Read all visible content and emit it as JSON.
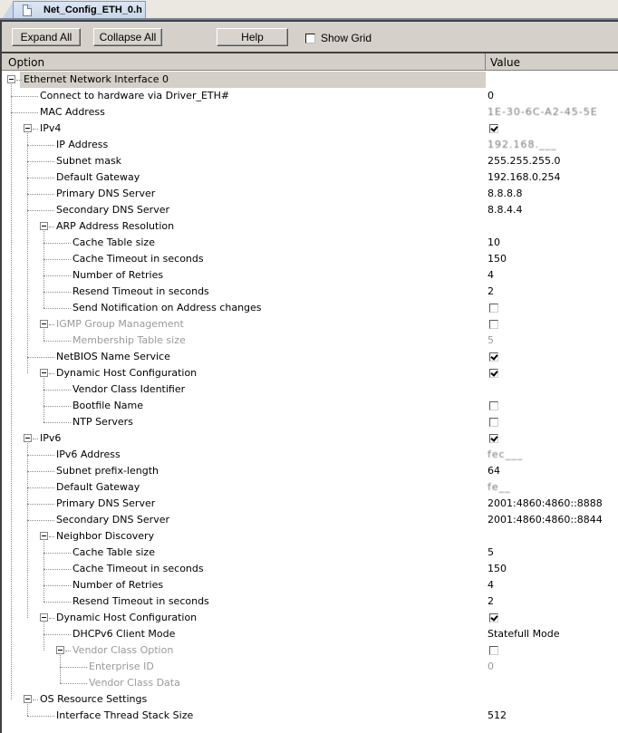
{
  "tab": {
    "label": "Net_Config_ETH_0.h",
    "icon": "document-icon"
  },
  "toolbar": {
    "expand_all": "Expand All",
    "collapse_all": "Collapse All",
    "help": "Help",
    "show_grid": "Show Grid",
    "show_grid_checked": false
  },
  "columns": {
    "option": "Option",
    "value": "Value"
  },
  "rows": [
    {
      "label": "Ethernet Network Interface 0",
      "level": 0,
      "expander": true,
      "value": ""
    },
    {
      "label": "Connect to hardware via Driver_ETH#",
      "level": 1,
      "value": "0"
    },
    {
      "label": "MAC Address",
      "level": 1,
      "value": "1E-30-6C-A2-45-5E",
      "obscured": true
    },
    {
      "label": "IPv4",
      "level": 1,
      "expander": true,
      "checkbox": true
    },
    {
      "label": "IP Address",
      "level": 2,
      "value": "192.168.___",
      "obscured": true
    },
    {
      "label": "Subnet mask",
      "level": 2,
      "value": "255.255.255.0"
    },
    {
      "label": "Default Gateway",
      "level": 2,
      "value": "192.168.0.254"
    },
    {
      "label": "Primary DNS Server",
      "level": 2,
      "value": "8.8.8.8"
    },
    {
      "label": "Secondary DNS Server",
      "level": 2,
      "value": "8.8.4.4"
    },
    {
      "label": "ARP Address Resolution",
      "level": 2,
      "expander": true,
      "value": ""
    },
    {
      "label": "Cache Table size",
      "level": 3,
      "value": "10"
    },
    {
      "label": "Cache Timeout in seconds",
      "level": 3,
      "value": "150"
    },
    {
      "label": "Number of Retries",
      "level": 3,
      "value": "4"
    },
    {
      "label": "Resend Timeout in seconds",
      "level": 3,
      "value": "2"
    },
    {
      "label": "Send Notification on Address changes",
      "level": 3,
      "checkbox": false
    },
    {
      "label": "IGMP Group Management",
      "level": 2,
      "expander": true,
      "checkbox": false,
      "disabled": true
    },
    {
      "label": "Membership Table size",
      "level": 3,
      "value": "5",
      "disabled": true
    },
    {
      "label": "NetBIOS Name Service",
      "level": 2,
      "checkbox": true
    },
    {
      "label": "Dynamic Host Configuration",
      "level": 2,
      "expander": true,
      "checkbox": true
    },
    {
      "label": "Vendor Class Identifier",
      "level": 3,
      "value": ""
    },
    {
      "label": "Bootfile Name",
      "level": 3,
      "checkbox": false
    },
    {
      "label": "NTP Servers",
      "level": 3,
      "checkbox": false
    },
    {
      "label": "IPv6",
      "level": 1,
      "expander": true,
      "checkbox": true
    },
    {
      "label": "IPv6 Address",
      "level": 2,
      "value": "fec___",
      "obscured": true
    },
    {
      "label": "Subnet prefix-length",
      "level": 2,
      "value": "64"
    },
    {
      "label": "Default Gateway",
      "level": 2,
      "value": "fe__",
      "obscured": true
    },
    {
      "label": "Primary DNS Server",
      "level": 2,
      "value": "2001:4860:4860::8888"
    },
    {
      "label": "Secondary DNS Server",
      "level": 2,
      "value": "2001:4860:4860::8844"
    },
    {
      "label": "Neighbor Discovery",
      "level": 2,
      "expander": true,
      "value": ""
    },
    {
      "label": "Cache Table size",
      "level": 3,
      "value": "5"
    },
    {
      "label": "Cache Timeout in seconds",
      "level": 3,
      "value": "150"
    },
    {
      "label": "Number of Retries",
      "level": 3,
      "value": "4"
    },
    {
      "label": "Resend Timeout in seconds",
      "level": 3,
      "value": "2"
    },
    {
      "label": "Dynamic Host Configuration",
      "level": 2,
      "expander": true,
      "checkbox": true
    },
    {
      "label": "DHCPv6 Client Mode",
      "level": 3,
      "value": "Statefull Mode"
    },
    {
      "label": "Vendor Class Option",
      "level": 3,
      "expander": true,
      "checkbox": false,
      "disabled": true
    },
    {
      "label": "Enterprise ID",
      "level": 4,
      "value": "0",
      "disabled": true
    },
    {
      "label": "Vendor Class Data",
      "level": 4,
      "value": "",
      "disabled": true
    },
    {
      "label": "OS Resource Settings",
      "level": 1,
      "expander": true,
      "value": ""
    },
    {
      "label": "Interface Thread Stack Size",
      "level": 2,
      "value": "512"
    }
  ]
}
